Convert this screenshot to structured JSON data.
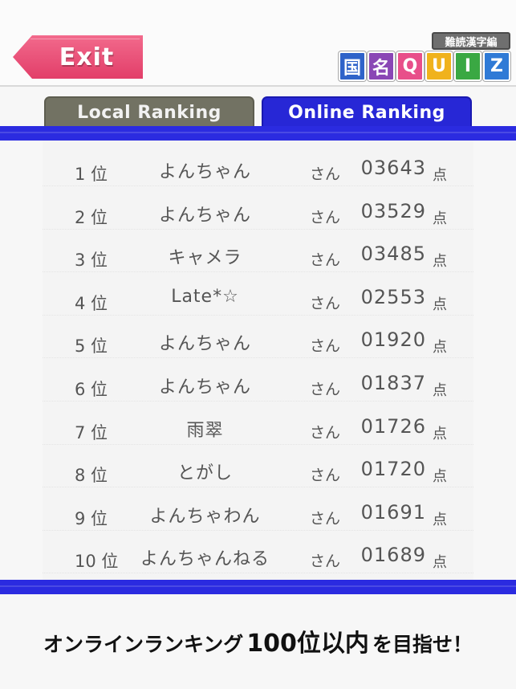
{
  "header": {
    "exit_label": "Exit",
    "logo_subtitle": "難読漢字編",
    "logo_tiles": [
      {
        "char": "国",
        "color": "#2f63c9"
      },
      {
        "char": "名",
        "color": "#8a47b5"
      },
      {
        "char": "Q",
        "color": "#e84f8a"
      },
      {
        "char": "U",
        "color": "#f0b21c"
      },
      {
        "char": "I",
        "color": "#3aa843"
      },
      {
        "char": "Z",
        "color": "#2f7ad6"
      }
    ]
  },
  "tabs": {
    "local": "Local Ranking",
    "online": "Online Ranking",
    "active": "online"
  },
  "ranking": {
    "honorific": "さん",
    "unit": "点",
    "rows": [
      {
        "rank": "1 位",
        "name": "よんちゃん",
        "score": "03643"
      },
      {
        "rank": "2 位",
        "name": "よんちゃん",
        "score": "03529"
      },
      {
        "rank": "3 位",
        "name": "キャメラ",
        "score": "03485"
      },
      {
        "rank": "4 位",
        "name": "Late*☆",
        "score": "02553"
      },
      {
        "rank": "5 位",
        "name": "よんちゃん",
        "score": "01920"
      },
      {
        "rank": "6 位",
        "name": "よんちゃん",
        "score": "01837"
      },
      {
        "rank": "7 位",
        "name": "雨翠",
        "score": "01726"
      },
      {
        "rank": "8 位",
        "name": "とがし",
        "score": "01720"
      },
      {
        "rank": "9 位",
        "name": "よんちゃわん",
        "score": "01691"
      },
      {
        "rank": "10 位",
        "name": "よんちゃんねる",
        "score": "01689"
      }
    ]
  },
  "footer": {
    "part1": "オンラインランキング",
    "part2": "100位以内",
    "part3": "を目指せ！"
  }
}
